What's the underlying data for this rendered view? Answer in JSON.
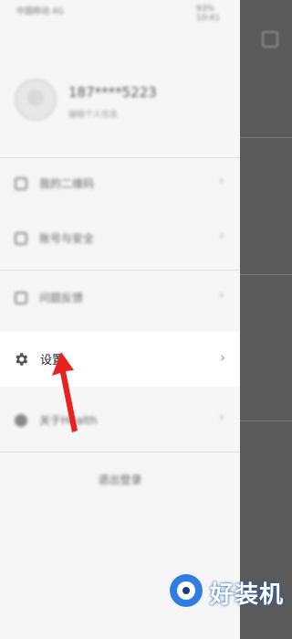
{
  "status_bar": {
    "left_text": "中国移动 4G",
    "right_text": "93% 10:41"
  },
  "profile": {
    "username": "187****5223",
    "subtext": "编辑个人信息"
  },
  "menu": {
    "items": [
      {
        "label": "我的二维码",
        "icon": "qrcode-icon"
      },
      {
        "label": "账号与安全",
        "icon": "lock-icon"
      },
      {
        "label": "问题反馈",
        "icon": "feedback-icon"
      }
    ],
    "settings": {
      "label": "设置",
      "icon": "gear-icon",
      "chevron": "›"
    },
    "about": {
      "label": "关于Health",
      "icon": "info-icon"
    },
    "chevron": "›"
  },
  "logout": {
    "label": "退出登录"
  },
  "watermark": {
    "text": "好装机"
  },
  "colors": {
    "overlay": "#5a5a5a",
    "annotation_arrow": "#e8231e",
    "watermark_blue": "#2f7de0"
  }
}
